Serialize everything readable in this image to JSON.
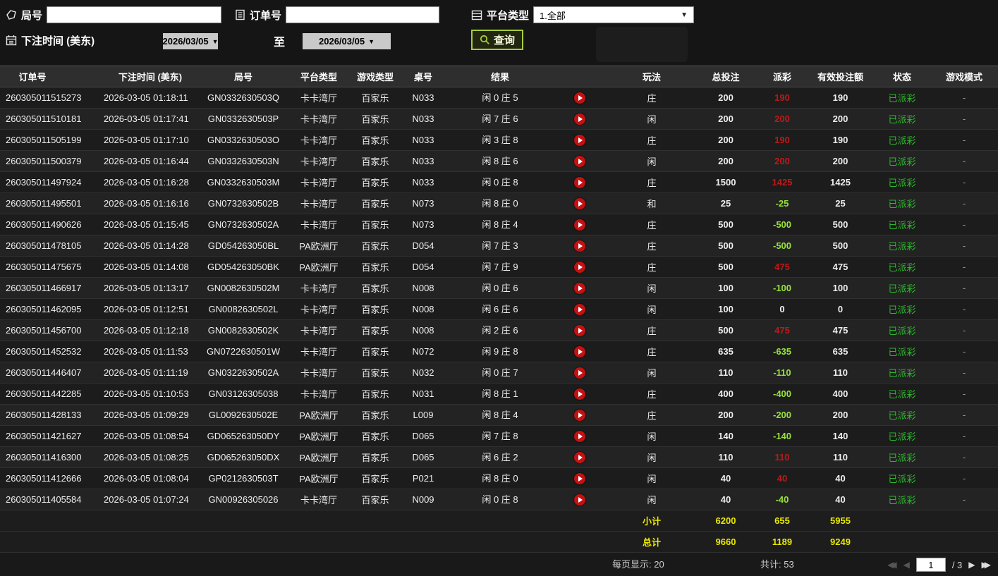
{
  "filters": {
    "game_id": {
      "label": "局号",
      "value": ""
    },
    "order_id": {
      "label": "订单号",
      "value": ""
    },
    "platform_type": {
      "label": "平台类型",
      "selected": "1.全部"
    },
    "bet_time": {
      "label": "下注时间 (美东)",
      "from": "2026/03/05",
      "to": "2026/03/05",
      "range_separator": "至"
    },
    "search_label": "查询"
  },
  "icons": {
    "game_id": "tag-icon",
    "order_id": "document-icon",
    "platform": "list-icon",
    "bet_time": "calendar-icon",
    "search": "magnifier-icon",
    "play": "play-icon",
    "dropdown": "chevron-down-icon"
  },
  "table": {
    "columns": [
      "订单号",
      "下注时间 (美东)",
      "局号",
      "平台类型",
      "游戏类型",
      "桌号",
      "结果",
      "玩法",
      "总投注",
      "派彩",
      "有效投注额",
      "状态",
      "游戏模式"
    ],
    "rows": [
      {
        "order_id": "260305011515273",
        "bet_time": "2026-03-05 01:18:11",
        "game_id": "GN0332630503Q",
        "platform": "卡卡湾厅",
        "game_type": "百家乐",
        "table_no": "N033",
        "result": "闲 0 庄 5",
        "bet_on": "庄",
        "total_bet": "200",
        "payout": "190",
        "payout_class": "pos",
        "valid_bet": "190",
        "status": "已派彩",
        "mode": "-"
      },
      {
        "order_id": "260305011510181",
        "bet_time": "2026-03-05 01:17:41",
        "game_id": "GN0332630503P",
        "platform": "卡卡湾厅",
        "game_type": "百家乐",
        "table_no": "N033",
        "result": "闲 7 庄 6",
        "bet_on": "闲",
        "total_bet": "200",
        "payout": "200",
        "payout_class": "pos",
        "valid_bet": "200",
        "status": "已派彩",
        "mode": "-"
      },
      {
        "order_id": "260305011505199",
        "bet_time": "2026-03-05 01:17:10",
        "game_id": "GN0332630503O",
        "platform": "卡卡湾厅",
        "game_type": "百家乐",
        "table_no": "N033",
        "result": "闲 3 庄 8",
        "bet_on": "庄",
        "total_bet": "200",
        "payout": "190",
        "payout_class": "pos",
        "valid_bet": "190",
        "status": "已派彩",
        "mode": "-"
      },
      {
        "order_id": "260305011500379",
        "bet_time": "2026-03-05 01:16:44",
        "game_id": "GN0332630503N",
        "platform": "卡卡湾厅",
        "game_type": "百家乐",
        "table_no": "N033",
        "result": "闲 8 庄 6",
        "bet_on": "闲",
        "total_bet": "200",
        "payout": "200",
        "payout_class": "pos",
        "valid_bet": "200",
        "status": "已派彩",
        "mode": "-"
      },
      {
        "order_id": "260305011497924",
        "bet_time": "2026-03-05 01:16:28",
        "game_id": "GN0332630503M",
        "platform": "卡卡湾厅",
        "game_type": "百家乐",
        "table_no": "N033",
        "result": "闲 0 庄 8",
        "bet_on": "庄",
        "total_bet": "1500",
        "payout": "1425",
        "payout_class": "pos",
        "valid_bet": "1425",
        "status": "已派彩",
        "mode": "-"
      },
      {
        "order_id": "260305011495501",
        "bet_time": "2026-03-05 01:16:16",
        "game_id": "GN0732630502B",
        "platform": "卡卡湾厅",
        "game_type": "百家乐",
        "table_no": "N073",
        "result": "闲 8 庄 0",
        "bet_on": "和",
        "total_bet": "25",
        "payout": "-25",
        "payout_class": "neg",
        "valid_bet": "25",
        "status": "已派彩",
        "mode": "-"
      },
      {
        "order_id": "260305011490626",
        "bet_time": "2026-03-05 01:15:45",
        "game_id": "GN0732630502A",
        "platform": "卡卡湾厅",
        "game_type": "百家乐",
        "table_no": "N073",
        "result": "闲 8 庄 4",
        "bet_on": "庄",
        "total_bet": "500",
        "payout": "-500",
        "payout_class": "neg",
        "valid_bet": "500",
        "status": "已派彩",
        "mode": "-"
      },
      {
        "order_id": "260305011478105",
        "bet_time": "2026-03-05 01:14:28",
        "game_id": "GD054263050BL",
        "platform": "PA欧洲厅",
        "game_type": "百家乐",
        "table_no": "D054",
        "result": "闲 7 庄 3",
        "bet_on": "庄",
        "total_bet": "500",
        "payout": "-500",
        "payout_class": "neg",
        "valid_bet": "500",
        "status": "已派彩",
        "mode": "-"
      },
      {
        "order_id": "260305011475675",
        "bet_time": "2026-03-05 01:14:08",
        "game_id": "GD054263050BK",
        "platform": "PA欧洲厅",
        "game_type": "百家乐",
        "table_no": "D054",
        "result": "闲 7 庄 9",
        "bet_on": "庄",
        "total_bet": "500",
        "payout": "475",
        "payout_class": "pos",
        "valid_bet": "475",
        "status": "已派彩",
        "mode": "-"
      },
      {
        "order_id": "260305011466917",
        "bet_time": "2026-03-05 01:13:17",
        "game_id": "GN0082630502M",
        "platform": "卡卡湾厅",
        "game_type": "百家乐",
        "table_no": "N008",
        "result": "闲 0 庄 6",
        "bet_on": "闲",
        "total_bet": "100",
        "payout": "-100",
        "payout_class": "neg",
        "valid_bet": "100",
        "status": "已派彩",
        "mode": "-"
      },
      {
        "order_id": "260305011462095",
        "bet_time": "2026-03-05 01:12:51",
        "game_id": "GN0082630502L",
        "platform": "卡卡湾厅",
        "game_type": "百家乐",
        "table_no": "N008",
        "result": "闲 6 庄 6",
        "bet_on": "闲",
        "total_bet": "100",
        "payout": "0",
        "payout_class": "zero",
        "valid_bet": "0",
        "status": "已派彩",
        "mode": "-"
      },
      {
        "order_id": "260305011456700",
        "bet_time": "2026-03-05 01:12:18",
        "game_id": "GN0082630502K",
        "platform": "卡卡湾厅",
        "game_type": "百家乐",
        "table_no": "N008",
        "result": "闲 2 庄 6",
        "bet_on": "庄",
        "total_bet": "500",
        "payout": "475",
        "payout_class": "pos",
        "valid_bet": "475",
        "status": "已派彩",
        "mode": "-"
      },
      {
        "order_id": "260305011452532",
        "bet_time": "2026-03-05 01:11:53",
        "game_id": "GN0722630501W",
        "platform": "卡卡湾厅",
        "game_type": "百家乐",
        "table_no": "N072",
        "result": "闲 9 庄 8",
        "bet_on": "庄",
        "total_bet": "635",
        "payout": "-635",
        "payout_class": "neg",
        "valid_bet": "635",
        "status": "已派彩",
        "mode": "-"
      },
      {
        "order_id": "260305011446407",
        "bet_time": "2026-03-05 01:11:19",
        "game_id": "GN0322630502A",
        "platform": "卡卡湾厅",
        "game_type": "百家乐",
        "table_no": "N032",
        "result": "闲 0 庄 7",
        "bet_on": "闲",
        "total_bet": "110",
        "payout": "-110",
        "payout_class": "neg",
        "valid_bet": "110",
        "status": "已派彩",
        "mode": "-"
      },
      {
        "order_id": "260305011442285",
        "bet_time": "2026-03-05 01:10:53",
        "game_id": "GN03126305038",
        "platform": "卡卡湾厅",
        "game_type": "百家乐",
        "table_no": "N031",
        "result": "闲 8 庄 1",
        "bet_on": "庄",
        "total_bet": "400",
        "payout": "-400",
        "payout_class": "neg",
        "valid_bet": "400",
        "status": "已派彩",
        "mode": "-"
      },
      {
        "order_id": "260305011428133",
        "bet_time": "2026-03-05 01:09:29",
        "game_id": "GL0092630502E",
        "platform": "PA欧洲厅",
        "game_type": "百家乐",
        "table_no": "L009",
        "result": "闲 8 庄 4",
        "bet_on": "庄",
        "total_bet": "200",
        "payout": "-200",
        "payout_class": "neg",
        "valid_bet": "200",
        "status": "已派彩",
        "mode": "-"
      },
      {
        "order_id": "260305011421627",
        "bet_time": "2026-03-05 01:08:54",
        "game_id": "GD065263050DY",
        "platform": "PA欧洲厅",
        "game_type": "百家乐",
        "table_no": "D065",
        "result": "闲 7 庄 8",
        "bet_on": "闲",
        "total_bet": "140",
        "payout": "-140",
        "payout_class": "neg",
        "valid_bet": "140",
        "status": "已派彩",
        "mode": "-"
      },
      {
        "order_id": "260305011416300",
        "bet_time": "2026-03-05 01:08:25",
        "game_id": "GD065263050DX",
        "platform": "PA欧洲厅",
        "game_type": "百家乐",
        "table_no": "D065",
        "result": "闲 6 庄 2",
        "bet_on": "闲",
        "total_bet": "110",
        "payout": "110",
        "payout_class": "pos",
        "valid_bet": "110",
        "status": "已派彩",
        "mode": "-"
      },
      {
        "order_id": "260305011412666",
        "bet_time": "2026-03-05 01:08:04",
        "game_id": "GP0212630503T",
        "platform": "PA欧洲厅",
        "game_type": "百家乐",
        "table_no": "P021",
        "result": "闲 8 庄 0",
        "bet_on": "闲",
        "total_bet": "40",
        "payout": "40",
        "payout_class": "pos",
        "valid_bet": "40",
        "status": "已派彩",
        "mode": "-"
      },
      {
        "order_id": "260305011405584",
        "bet_time": "2026-03-05 01:07:24",
        "game_id": "GN00926305026",
        "platform": "卡卡湾厅",
        "game_type": "百家乐",
        "table_no": "N009",
        "result": "闲 0 庄 8",
        "bet_on": "闲",
        "total_bet": "40",
        "payout": "-40",
        "payout_class": "neg",
        "valid_bet": "40",
        "status": "已派彩",
        "mode": "-"
      }
    ],
    "subtotal": {
      "label": "小计",
      "total_bet": "6200",
      "payout": "655",
      "valid_bet": "5955"
    },
    "total": {
      "label": "总计",
      "total_bet": "9660",
      "payout": "1189",
      "valid_bet": "9249"
    }
  },
  "footer": {
    "page_size_label": "每页显示: 20",
    "total_label": "共计: 53",
    "page": "1",
    "page_total": "/ 3"
  },
  "colors": {
    "payout_positive": "#c01818",
    "payout_negative": "#97e23c",
    "status_paid": "#2eb82e",
    "summary_yellow": "#e8e800",
    "query_border": "#a8cc3a",
    "play_button_red": "#c41111"
  }
}
